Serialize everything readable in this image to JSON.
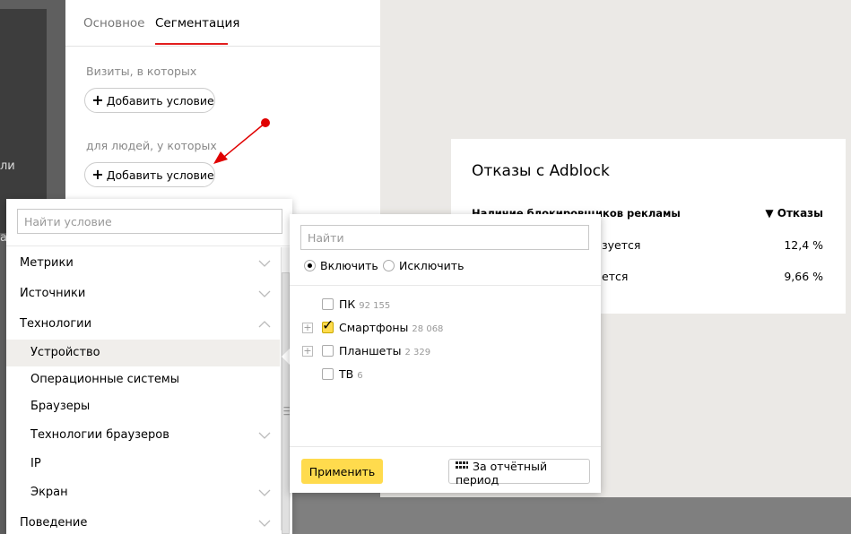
{
  "background": {
    "side_fragments": [
      "ли",
      "а"
    ]
  },
  "segmentation": {
    "tabs": [
      {
        "label": "Основное",
        "active": false
      },
      {
        "label": "Сегментация",
        "active": true
      }
    ],
    "visits_label": "Визиты, в которых",
    "people_label": "для людей, у которых",
    "add_condition_label": "Добавить условие"
  },
  "report": {
    "title": "Отказы с Adblock",
    "column_dimension": "Наличие блокировщиков рекламы",
    "column_metric": "▼ Отказы",
    "rows": [
      {
        "dimension": "зуется",
        "value": "12,4 %"
      },
      {
        "dimension": "ется",
        "value": "9,66 %"
      }
    ]
  },
  "conditions": {
    "search_placeholder": "Найти условие",
    "items": [
      {
        "label": "Метрики",
        "chevron": "down"
      },
      {
        "label": "Источники",
        "chevron": "down"
      },
      {
        "label": "Технологии",
        "chevron": "up"
      },
      {
        "label": "Устройство",
        "chevron": ""
      },
      {
        "label": "Операционные системы",
        "chevron": ""
      },
      {
        "label": "Браузеры",
        "chevron": ""
      },
      {
        "label": "Технологии браузеров",
        "chevron": "down"
      },
      {
        "label": "IP",
        "chevron": ""
      },
      {
        "label": "Экран",
        "chevron": "down"
      },
      {
        "label": "Поведение",
        "chevron": "down"
      }
    ]
  },
  "values_popup": {
    "search_placeholder": "Найти",
    "include_label": "Включить",
    "exclude_label": "Исключить",
    "selected_mode": "include",
    "values": [
      {
        "name": "ПК",
        "count": "92 155",
        "checked": false,
        "expandable": false
      },
      {
        "name": "Смартфоны",
        "count": "28 068",
        "checked": true,
        "expandable": true
      },
      {
        "name": "Планшеты",
        "count": "2 329",
        "checked": false,
        "expandable": true
      },
      {
        "name": "ТВ",
        "count": "6",
        "checked": false,
        "expandable": false
      }
    ],
    "apply_label": "Применить",
    "period_label": "За отчётный период"
  },
  "colors": {
    "accent_yellow": "#ffdb4d",
    "tab_underline": "#e21d1d",
    "pointer_red": "#e00000"
  }
}
